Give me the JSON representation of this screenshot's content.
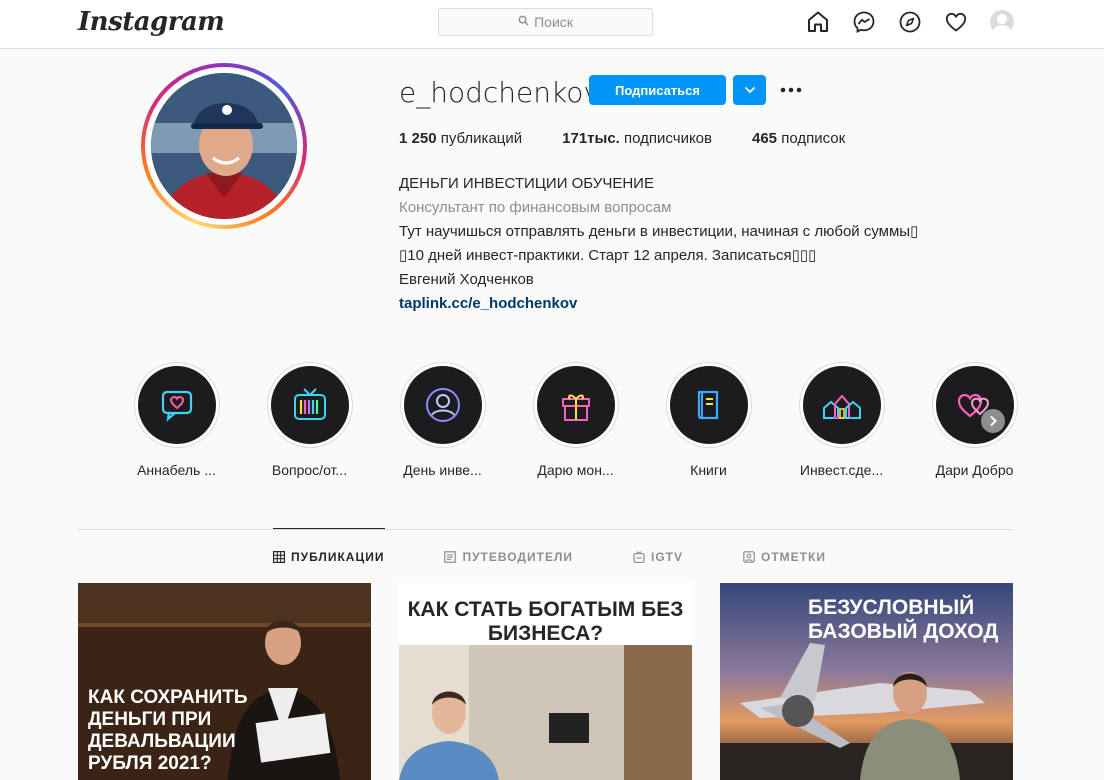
{
  "header": {
    "logo": "Instagram",
    "search_placeholder": "Поиск"
  },
  "profile": {
    "username": "e_hodchenkov",
    "follow_label": "Подписаться",
    "stats": [
      {
        "value": "1 250",
        "label": "публикаций"
      },
      {
        "value": "171тыс.",
        "label": "подписчиков"
      },
      {
        "value": "465",
        "label": "подписок"
      }
    ],
    "bio": {
      "name": "ДЕНЬГИ ИНВЕСТИЦИИ ОБУЧЕНИЕ",
      "category": "Консультант по финансовым вопросам",
      "line1": "Тут научишься отправлять деньги в инвестиции, начиная с любой суммы",
      "line2": "10 дней инвест-практики. Старт 12 апреля. Записаться",
      "line3": "Евгений Ходченков",
      "link": "taplink.cc/e_hodchenkov"
    }
  },
  "highlights": [
    {
      "label": "Аннабель ...",
      "icon": "chat-heart-icon",
      "color": "#3fd3f5"
    },
    {
      "label": "Вопрос/от...",
      "icon": "tv-icon",
      "color": "#b57cff"
    },
    {
      "label": "День инве...",
      "icon": "person-icon",
      "color": "#8a8cff"
    },
    {
      "label": "Дарю мон...",
      "icon": "gift-icon",
      "color": "#ff5fbf"
    },
    {
      "label": "Книги",
      "icon": "book-icon",
      "color": "#3fa8ff"
    },
    {
      "label": "Инвест.сде...",
      "icon": "houses-icon",
      "color": "#3fd3f5"
    },
    {
      "label": "Дари Добро",
      "icon": "hearts-icon",
      "color": "#ff5fbf"
    }
  ],
  "tabs": [
    {
      "label": "ПУБЛИКАЦИИ",
      "active": true
    },
    {
      "label": "ПУТЕВОДИТЕЛИ",
      "active": false
    },
    {
      "label": "IGTV",
      "active": false
    },
    {
      "label": "ОТМЕТКИ",
      "active": false
    }
  ],
  "posts": [
    {
      "title": "КАК СОХРАНИТЬ ДЕНЬГИ ПРИ ДЕВАЛЬВАЦИИ РУБЛЯ 2021?"
    },
    {
      "title": "КАК СТАТЬ БОГАТЫМ БЕЗ БИЗНЕСА?"
    },
    {
      "title": "БЕЗУСЛОВНЫЙ БАЗОВЫЙ ДОХОД"
    }
  ]
}
